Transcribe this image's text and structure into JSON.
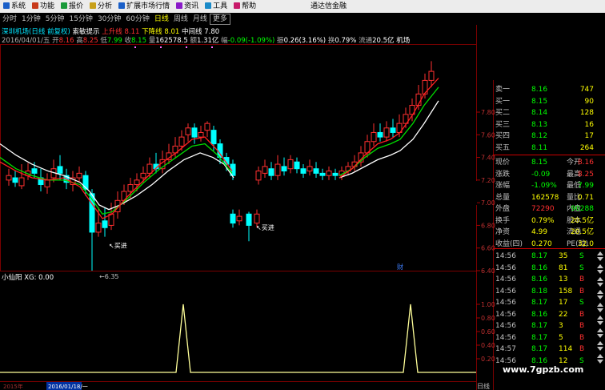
{
  "menu": {
    "items": [
      {
        "label": "系统",
        "color": "#1a5fc8"
      },
      {
        "label": "功能",
        "color": "#c83a1a"
      },
      {
        "label": "报价",
        "color": "#1a9a3a"
      },
      {
        "label": "分析",
        "color": "#c8a01a"
      },
      {
        "label": "扩展市场行情",
        "color": "#1a5fc8"
      },
      {
        "label": "资讯",
        "color": "#8a1ac8"
      },
      {
        "label": "工具",
        "color": "#1a8ac8"
      },
      {
        "label": "帮助",
        "color": "#c81a6a"
      }
    ],
    "brand": "通达信金融"
  },
  "periods": [
    {
      "label": "分时"
    },
    {
      "label": "1分钟"
    },
    {
      "label": "5分钟"
    },
    {
      "label": "15分钟"
    },
    {
      "label": "30分钟"
    },
    {
      "label": "60分钟"
    },
    {
      "label": "日线",
      "active": true
    },
    {
      "label": "周线"
    },
    {
      "label": "月线"
    },
    {
      "label": "更多",
      "boxed": true
    }
  ],
  "header": {
    "stock": "深圳机场(日线 前复权)",
    "indicator": "索敏提示",
    "up_label": "上升线",
    "up_value": "8.11",
    "down_label": "下降线",
    "down_value": "8.01",
    "mid_label": "中间线",
    "mid_value": "7.80"
  },
  "quote_line": {
    "date": "2016/04/01/五",
    "open_l": "开",
    "open": "8.16",
    "high_l": "高",
    "high": "8.25",
    "low_l": "低",
    "low": "7.99",
    "close_l": "收",
    "close": "8.15",
    "vol_l": "量",
    "vol": "162578.5",
    "amt_l": "额",
    "amt": "1.31亿",
    "chg_l": "幅",
    "chg": "-0.09(-1.09%)",
    "amp_l": "振",
    "amp": "0.26(3.16%)",
    "turn_l": "换",
    "turn": "0.79%",
    "cap_l": "流通",
    "cap": "20.5亿",
    "sector": "机场"
  },
  "annotations": {
    "buy1": "↖买进",
    "buy2": "↖买进",
    "low": "←6.35",
    "cai": "财"
  },
  "indicator_panel": {
    "title": "小仙阳 XG: 0.00"
  },
  "axis_labels": {
    "price": [
      "7.80",
      "7.60",
      "7.40",
      "7.20",
      "7.00",
      "6.80",
      "6.60",
      "6.40"
    ],
    "indicator": [
      "1.00",
      "0.80",
      "0.60",
      "0.40",
      "0.20"
    ],
    "bottom_date": "2016/01/18/一",
    "bottom_year": "2015年",
    "bottom_right": "日线"
  },
  "order_book": [
    {
      "label": "卖一",
      "price": "8.16",
      "vol": "747"
    },
    {
      "label": "买一",
      "price": "8.15",
      "vol": "90"
    },
    {
      "label": "买二",
      "price": "8.14",
      "vol": "128"
    },
    {
      "label": "买三",
      "price": "8.13",
      "vol": "16"
    },
    {
      "label": "买四",
      "price": "8.12",
      "vol": "17"
    },
    {
      "label": "买五",
      "price": "8.11",
      "vol": "264"
    }
  ],
  "stats": [
    {
      "l1": "现价",
      "v1": "8.15",
      "l2": "今开",
      "v2": "8.16"
    },
    {
      "l1": "涨跌",
      "v1": "-0.09",
      "l2": "最高",
      "v2": "8.25"
    },
    {
      "l1": "涨幅",
      "v1": "-1.09%",
      "l2": "最低",
      "v2": "7.99"
    },
    {
      "l1": "总量",
      "v1": "162578",
      "l2": "量比",
      "v2": "0.71"
    },
    {
      "l1": "外盘",
      "v1": "72290",
      "l2": "内盘",
      "v2": "90288"
    },
    {
      "l1": "换手",
      "v1": "0.79%",
      "l2": "股本",
      "v2": "20.5亿"
    },
    {
      "l1": "净资",
      "v1": "4.99",
      "l2": "流通",
      "v2": "20.5亿"
    },
    {
      "l1": "收益(四)",
      "v1": "0.270",
      "l2": "PE(动)",
      "v2": "32.0"
    }
  ],
  "ticks": [
    {
      "time": "14:56",
      "price": "8.17",
      "vol": "35",
      "side": "S"
    },
    {
      "time": "14:56",
      "price": "8.16",
      "vol": "81",
      "side": "S"
    },
    {
      "time": "14:56",
      "price": "8.16",
      "vol": "13",
      "side": "B"
    },
    {
      "time": "14:56",
      "price": "8.18",
      "vol": "158",
      "side": "B"
    },
    {
      "time": "14:56",
      "price": "8.17",
      "vol": "17",
      "side": "S"
    },
    {
      "time": "14:56",
      "price": "8.16",
      "vol": "22",
      "side": "B"
    },
    {
      "time": "14:56",
      "price": "8.17",
      "vol": "3",
      "side": "B"
    },
    {
      "time": "14:56",
      "price": "8.17",
      "vol": "5",
      "side": "B"
    },
    {
      "time": "14:57",
      "price": "8.17",
      "vol": "114",
      "side": "B"
    },
    {
      "time": "14:56",
      "price": "8.16",
      "vol": "12",
      "side": "S"
    }
  ],
  "watermark": "www.7gpzb.com",
  "colors": {
    "up": "#ff3030",
    "down": "#00ffff",
    "ma_white": "#ffffff",
    "ma_green": "#00dd00",
    "ma_red": "#ff2020",
    "indicator": "#ffff99"
  }
}
